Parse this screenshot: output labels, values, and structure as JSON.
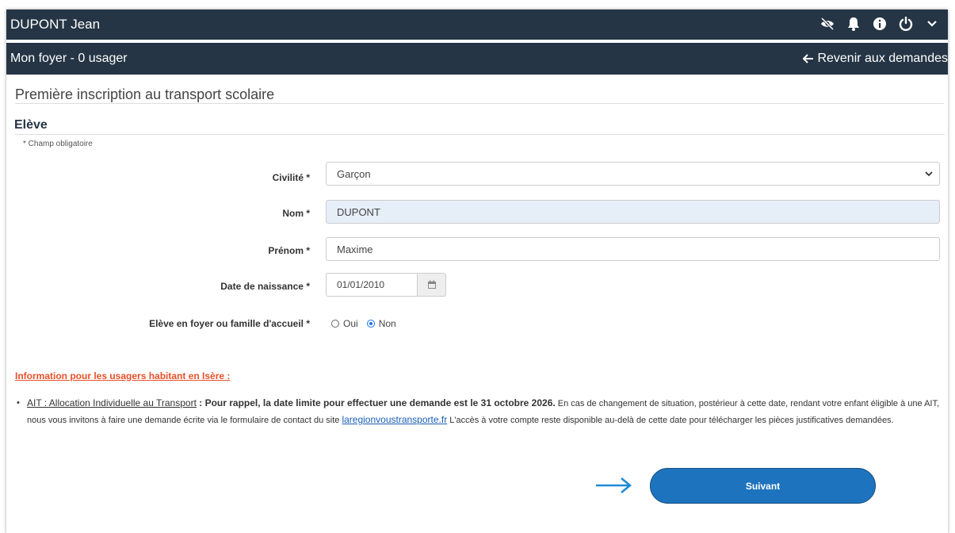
{
  "header": {
    "user_name": "DUPONT Jean",
    "icons": [
      "eye-slash-icon",
      "bell-icon",
      "info-icon",
      "power-icon",
      "chevron-down-icon"
    ]
  },
  "subheader": {
    "title": "Mon foyer - 0 usager",
    "back_label": "Revenir aux demandes"
  },
  "page": {
    "title": "Première inscription au transport scolaire",
    "section": "Elève",
    "required_note": "* Champ obligatoire"
  },
  "form": {
    "civilite": {
      "label": "Civilité *",
      "value": "Garçon"
    },
    "nom": {
      "label": "Nom *",
      "value": "DUPONT"
    },
    "prenom": {
      "label": "Prénom *",
      "value": "Maxime"
    },
    "date_naissance": {
      "label": "Date de naissance *",
      "value": "01/01/2010"
    },
    "foyer": {
      "label": "Elève en foyer ou famille d'accueil *",
      "options": [
        "Oui",
        "Non"
      ],
      "selected": "Non"
    }
  },
  "info": {
    "heading": "Information pour les usagers habitant en Isère :",
    "ait_label": "AIT : Allocation Individuelle au Transport",
    "colon": " : ",
    "bold_text": "Pour rappel, la date limite pour effectuer une demande est le 31 octobre 2026.",
    "text_before_link": " En cas de changement de situation, postérieur à cette date, rendant votre enfant éligible à une AIT, nous vous invitons à faire une demande écrite via le formulaire de contact du site ",
    "link_text": "laregionvoustransporte.fr",
    "text_after_link": " L'accès à votre compte reste disponible au-delà de cette date pour télécharger les pièces justificatives demandées."
  },
  "actions": {
    "next_label": "Suivant"
  },
  "colors": {
    "header_bg": "#253545",
    "accent": "#1e73be",
    "info_heading": "#e8512a"
  }
}
